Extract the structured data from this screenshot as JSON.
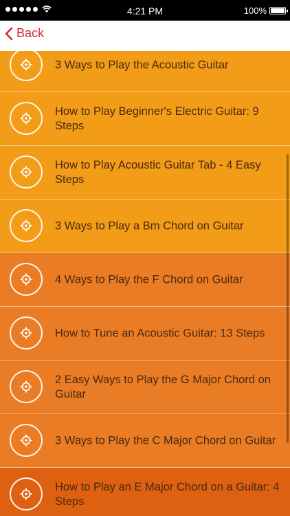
{
  "status_bar": {
    "time": "4:21 PM",
    "battery": "100%",
    "battery_level": 1.0
  },
  "nav": {
    "back_label": "Back"
  },
  "colors": {
    "accent": "#d0272f",
    "orange_light": "#f29c17",
    "orange_mid": "#ea7c25",
    "orange_dark": "#de6011"
  },
  "items": [
    {
      "title": "3 Ways to Play the Acoustic Guitar",
      "color": "#f29c17"
    },
    {
      "title": "How to Play Beginner's Electric Guitar: 9 Steps",
      "color": "#f29c17"
    },
    {
      "title": "How to Play Acoustic Guitar Tab - 4 Easy Steps",
      "color": "#f29c17"
    },
    {
      "title": "3 Ways to Play a Bm Chord on Guitar",
      "color": "#f29c17"
    },
    {
      "title": "4 Ways to Play the F Chord on Guitar",
      "color": "#ea7c25"
    },
    {
      "title": "How to Tune an Acoustic Guitar: 13 Steps",
      "color": "#ea7c25"
    },
    {
      "title": "2 Easy Ways to Play the G Major Chord on Guitar",
      "color": "#ea7c25"
    },
    {
      "title": "3 Ways to Play the C Major Chord on Guitar",
      "color": "#ea7c25"
    },
    {
      "title": "How to Play an E Major Chord on a Guitar: 4 Steps",
      "color": "#de6011"
    }
  ]
}
